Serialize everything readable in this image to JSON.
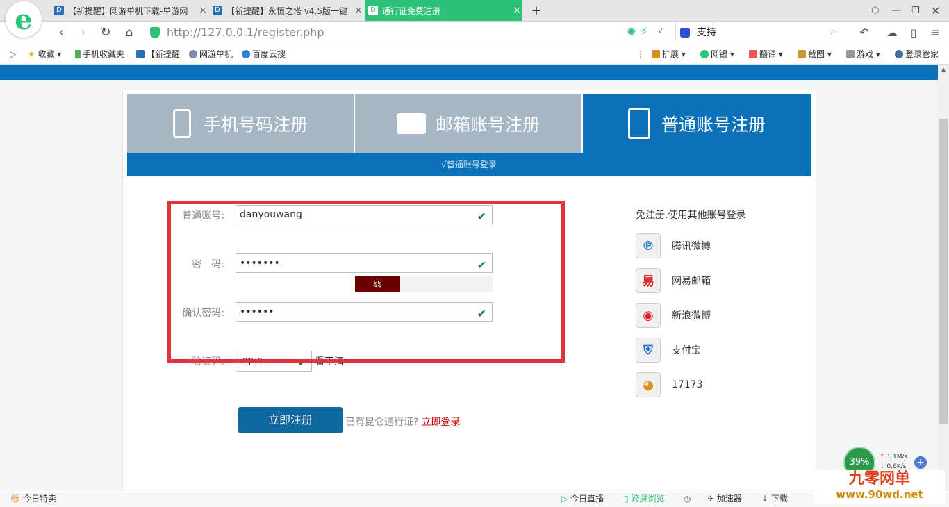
{
  "browser": {
    "tabs": [
      {
        "label": "【新提醒】网游单机下载-单游网",
        "active": false
      },
      {
        "label": "【新提醒】永恒之塔 v4.5版一键",
        "active": false
      },
      {
        "label": "通行证免费注册",
        "active": true
      }
    ],
    "new_tab": "+",
    "url": "http://127.0.0.1/register.php",
    "search_text": "支持",
    "bookmarks": [
      "收藏",
      "手机收藏夹",
      "【新提醒",
      "网游单机",
      "百度云搜"
    ],
    "tools": [
      "扩展",
      "网银",
      "翻译",
      "截图",
      "游戏",
      "登录管家"
    ]
  },
  "register": {
    "tabs": [
      {
        "label": "手机号码注册",
        "icon": "phone-icon"
      },
      {
        "label": "邮箱账号注册",
        "icon": "mail-icon"
      },
      {
        "label": "普通账号注册",
        "icon": "document-icon"
      }
    ],
    "subtitle": "√普通账号登录",
    "fields": {
      "account_label": "普通账号:",
      "account_value": "danyouwang",
      "password_label": "密　码:",
      "password_value": "•••••••",
      "strength": "弱",
      "confirm_label": "确认密码:",
      "confirm_value": "••••••",
      "captcha_label": "验证码:",
      "captcha_value": "zquc",
      "captcha_refresh": "看不清"
    },
    "submit": "立即注册",
    "have_account": "已有昆仑通行证?",
    "login_link": "立即登录",
    "third_party_title": "免注册.使用其他账号登录",
    "third_party": [
      "腾讯微博",
      "网易邮箱",
      "新浪微博",
      "支付宝",
      "17173"
    ]
  },
  "speed_widget": {
    "percent": "39%",
    "up": "1.1M/s",
    "down": "0.6K/s"
  },
  "watermark": {
    "title": "九零网单",
    "url": "www.90wd.net"
  },
  "statusbar": {
    "left": "今日特卖",
    "items": [
      "今日直播",
      "跨屏浏览",
      "加速器",
      "下载"
    ]
  },
  "colors": {
    "accent": "#0b71b8",
    "tab_green": "#2cc277",
    "error_red": "#e0353b",
    "strength_weak": "#6b0000"
  }
}
